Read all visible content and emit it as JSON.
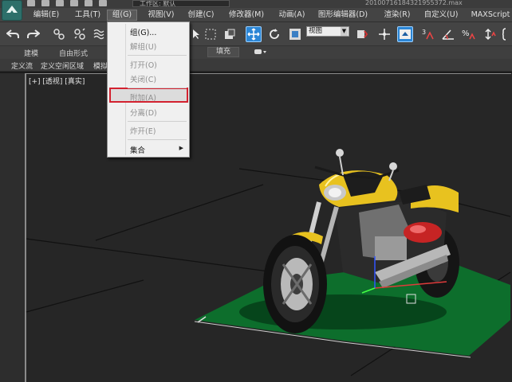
{
  "titlebar": {
    "workspace": "工作区: 默认",
    "file_title": "20100716184321955372.max"
  },
  "menubar": {
    "items": [
      "编辑(E)",
      "工具(T)",
      "组(G)",
      "视图(V)",
      "创建(C)",
      "修改器(M)",
      "动画(A)",
      "图形编辑器(D)",
      "渲染(R)",
      "自定义(U)",
      "MAXScript"
    ],
    "active_index": 2
  },
  "toolbar": {
    "view_dropdown": "视图"
  },
  "ribbon": {
    "tabs": [
      "建模",
      "自由形式"
    ],
    "fill_label": "填充"
  },
  "subribbon": {
    "items": [
      "定义流",
      "定义空闲区域",
      "模拟"
    ]
  },
  "viewport": {
    "label": "[+] [透视] [真实]"
  },
  "group_menu": {
    "items": [
      {
        "label": "组(G)...",
        "enabled": true
      },
      {
        "label": "解组(U)",
        "enabled": false
      },
      {
        "label": "打开(O)",
        "enabled": false
      },
      {
        "label": "关闭(C)",
        "enabled": false
      },
      {
        "label": "附加(A)",
        "enabled": false,
        "highlighted": true
      },
      {
        "label": "分离(D)",
        "enabled": false
      },
      {
        "label": "炸开(E)",
        "enabled": false
      },
      {
        "label": "集合",
        "enabled": true,
        "submenu": true
      }
    ]
  },
  "colors": {
    "highlight_border": "#d3212f",
    "active_tool": "#2b86d6",
    "ground_plane": "#0d6e2c",
    "bike_yellow": "#e8c21f"
  }
}
